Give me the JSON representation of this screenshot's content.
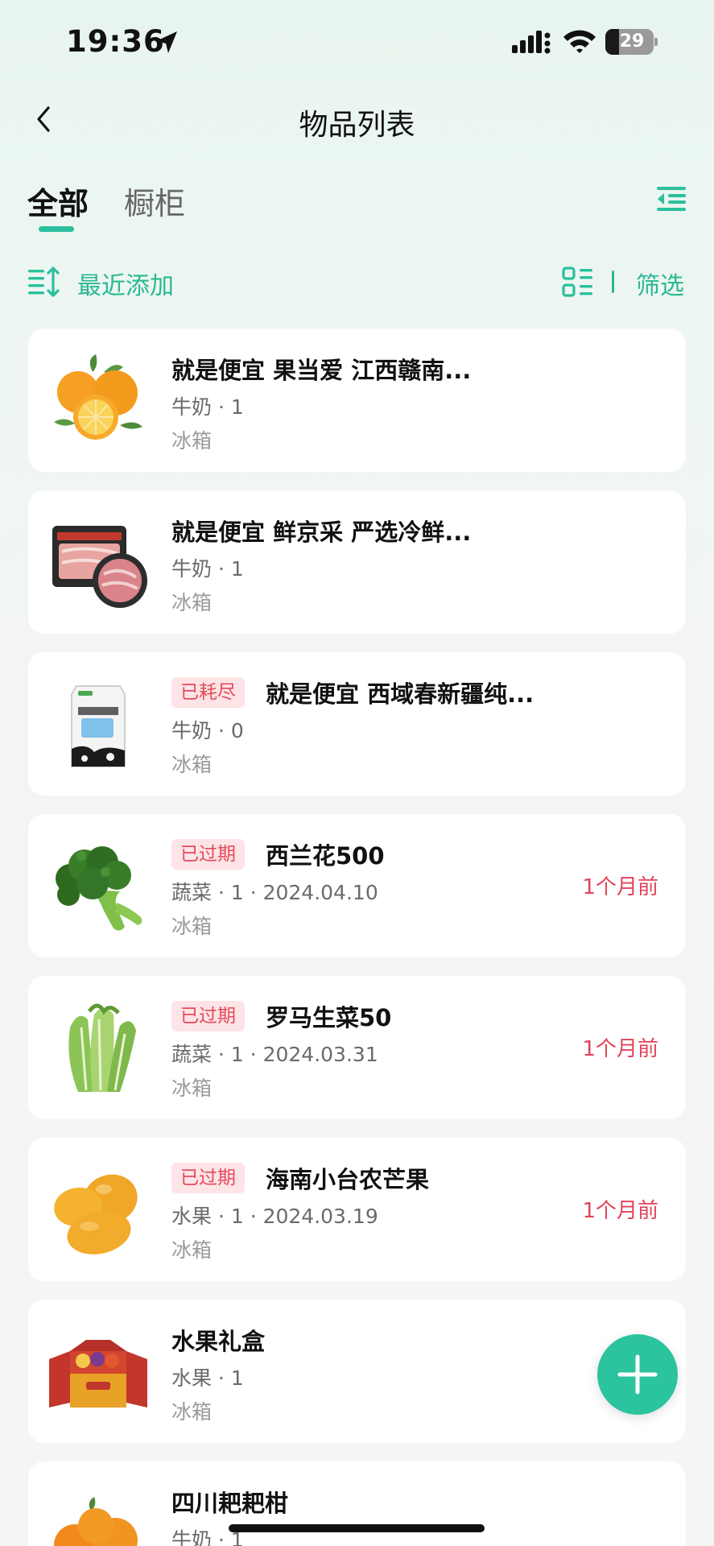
{
  "status": {
    "time": "19:36",
    "battery": "29",
    "battery_fraction": 0.29
  },
  "header": {
    "title": "物品列表"
  },
  "tabs": [
    {
      "label": "全部"
    },
    {
      "label": "橱柜"
    }
  ],
  "toolbar": {
    "sort_label": "最近添加",
    "filter_label": "筛选"
  },
  "items": [
    {
      "name": "就是便宜 果当爱 江西赣南...",
      "badge": "",
      "meta": "牛奶 · 1",
      "location": "冰箱",
      "age": ""
    },
    {
      "name": "就是便宜 鲜京采 严选冷鲜...",
      "badge": "",
      "meta": "牛奶 · 1",
      "location": "冰箱",
      "age": ""
    },
    {
      "name": "就是便宜 西域春新疆纯...",
      "badge": "已耗尽",
      "meta": "牛奶 · 0",
      "location": "冰箱",
      "age": ""
    },
    {
      "name": "西兰花500",
      "badge": "已过期",
      "meta": "蔬菜 · 1 · 2024.04.10",
      "location": "冰箱",
      "age": "1个月前"
    },
    {
      "name": "罗马生菜50",
      "badge": "已过期",
      "meta": "蔬菜 · 1 · 2024.03.31",
      "location": "冰箱",
      "age": "1个月前"
    },
    {
      "name": "海南小台农芒果",
      "badge": "已过期",
      "meta": "水果 · 1 · 2024.03.19",
      "location": "冰箱",
      "age": "1个月前"
    },
    {
      "name": "水果礼盒",
      "badge": "",
      "meta": "水果 · 1",
      "location": "冰箱",
      "age": ""
    },
    {
      "name": "四川耙耙柑",
      "badge": "",
      "meta": "牛奶 · 1",
      "location": "",
      "age": ""
    }
  ],
  "product_images": [
    "oranges",
    "beef-pack",
    "milk-carton",
    "broccoli",
    "romaine-lettuce",
    "mangoes",
    "fruit-gift-box",
    "tangerines"
  ],
  "icons": {
    "back": "chevron-left-icon",
    "menu": "indent-menu-icon",
    "sort": "sort-icon",
    "view": "grid-list-icon",
    "fab": "plus-icon"
  },
  "colors": {
    "accent": "#2bbf9e",
    "alert": "#e0445a",
    "badge_bg": "#fde4e6"
  },
  "fab": {
    "symbol": "+"
  }
}
